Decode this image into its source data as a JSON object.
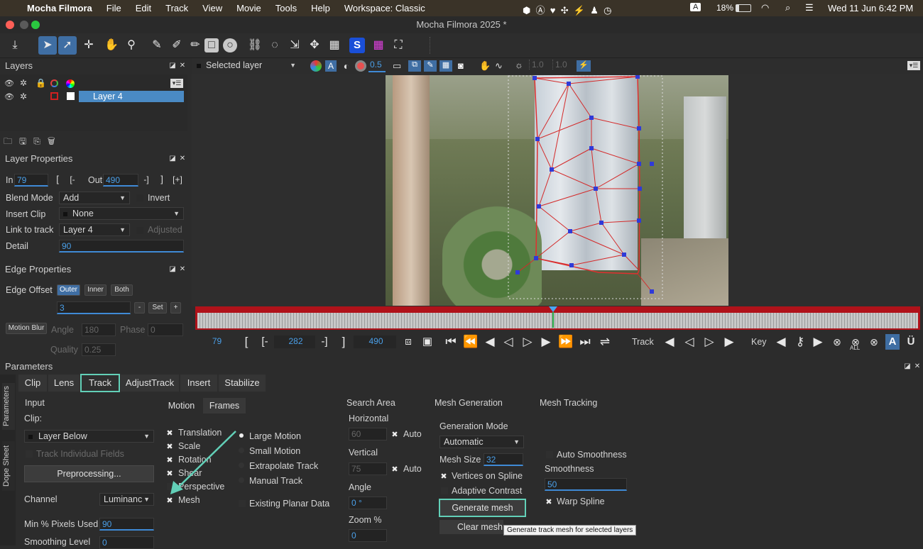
{
  "menubar": {
    "app": "Mocha Filmora",
    "items": [
      "File",
      "Edit",
      "Track",
      "View",
      "Movie",
      "Tools",
      "Help",
      "Workspace: Classic"
    ],
    "battery": "18%",
    "datetime": "Wed 11 Jun  6:42 PM"
  },
  "window": {
    "title": "Mocha Filmora 2025 *"
  },
  "layers": {
    "title": "Layers",
    "items": [
      {
        "name": "Layer 4"
      }
    ]
  },
  "viewer": {
    "layer_select": "Selected layer",
    "opacity": "0.5",
    "val1": "1.0",
    "val2": "1.0"
  },
  "layer_props": {
    "title": "Layer Properties",
    "in_label": "In",
    "in_value": "79",
    "out_label": "Out",
    "out_value": "490",
    "blend_label": "Blend Mode",
    "blend_value": "Add",
    "invert_label": "Invert",
    "insert_label": "Insert Clip",
    "insert_value": "None",
    "link_label": "Link to track",
    "link_value": "Layer 4",
    "adjusted_label": "Adjusted",
    "detail_label": "Detail",
    "detail_value": "90"
  },
  "edge_props": {
    "title": "Edge Properties",
    "offset_label": "Edge Offset",
    "outer": "Outer",
    "inner": "Inner",
    "both": "Both",
    "offset_value": "3",
    "set": "Set",
    "motion_blur": "Motion Blur",
    "angle_label": "Angle",
    "angle_value": "180",
    "phase_label": "Phase",
    "phase_value": "0",
    "quality_label": "Quality",
    "quality_value": "0.25"
  },
  "timeline": {
    "start": "79",
    "current": "282",
    "end": "490",
    "track_label": "Track",
    "key_label": "Key",
    "all": "ALL"
  },
  "parameters": {
    "title": "Parameters",
    "side_tabs": [
      "Parameters",
      "Dope Sheet"
    ],
    "tabs": [
      "Clip",
      "Lens",
      "Track",
      "AdjustTrack",
      "Insert",
      "Stabilize"
    ],
    "input": {
      "title": "Input",
      "clip_label": "Clip:",
      "clip_value": "Layer Below",
      "track_individual": "Track Individual Fields",
      "preprocessing": "Preprocessing...",
      "channel_label": "Channel",
      "channel_value": "Luminanc",
      "min_pixels_label": "Min % Pixels Used",
      "min_pixels_value": "90",
      "smoothing_label": "Smoothing Level",
      "smoothing_value": "0"
    },
    "motion": {
      "tab_motion": "Motion",
      "tab_frames": "Frames",
      "items": [
        "Translation",
        "Scale",
        "Rotation",
        "Shear",
        "Perspective",
        "Mesh"
      ],
      "modes": [
        "Large Motion",
        "Small Motion",
        "Extrapolate Track",
        "Manual Track"
      ],
      "existing": "Existing Planar Data"
    },
    "search": {
      "title": "Search Area",
      "horizontal": "Horizontal",
      "h_value": "60",
      "auto": "Auto",
      "vertical": "Vertical",
      "v_value": "75",
      "angle": "Angle",
      "angle_value": "0 °",
      "zoom": "Zoom %",
      "zoom_value": "0"
    },
    "mesh_gen": {
      "title": "Mesh Generation",
      "mode_label": "Generation Mode",
      "mode_value": "Automatic",
      "size_label": "Mesh Size",
      "size_value": "32",
      "vertices": "Vertices on Spline",
      "adaptive": "Adaptive Contrast",
      "generate": "Generate mesh",
      "clear": "Clear mesh",
      "tooltip": "Generate track mesh for selected layers"
    },
    "mesh_track": {
      "title": "Mesh Tracking",
      "auto_smooth": "Auto Smoothness",
      "smoothness_label": "Smoothness",
      "smoothness_value": "50",
      "warp": "Warp Spline"
    }
  },
  "colors": {
    "accent": "#3f6ea3",
    "highlight": "#62d0b8",
    "timeline_red": "#b0121a",
    "value_blue": "#4a9fe8"
  }
}
